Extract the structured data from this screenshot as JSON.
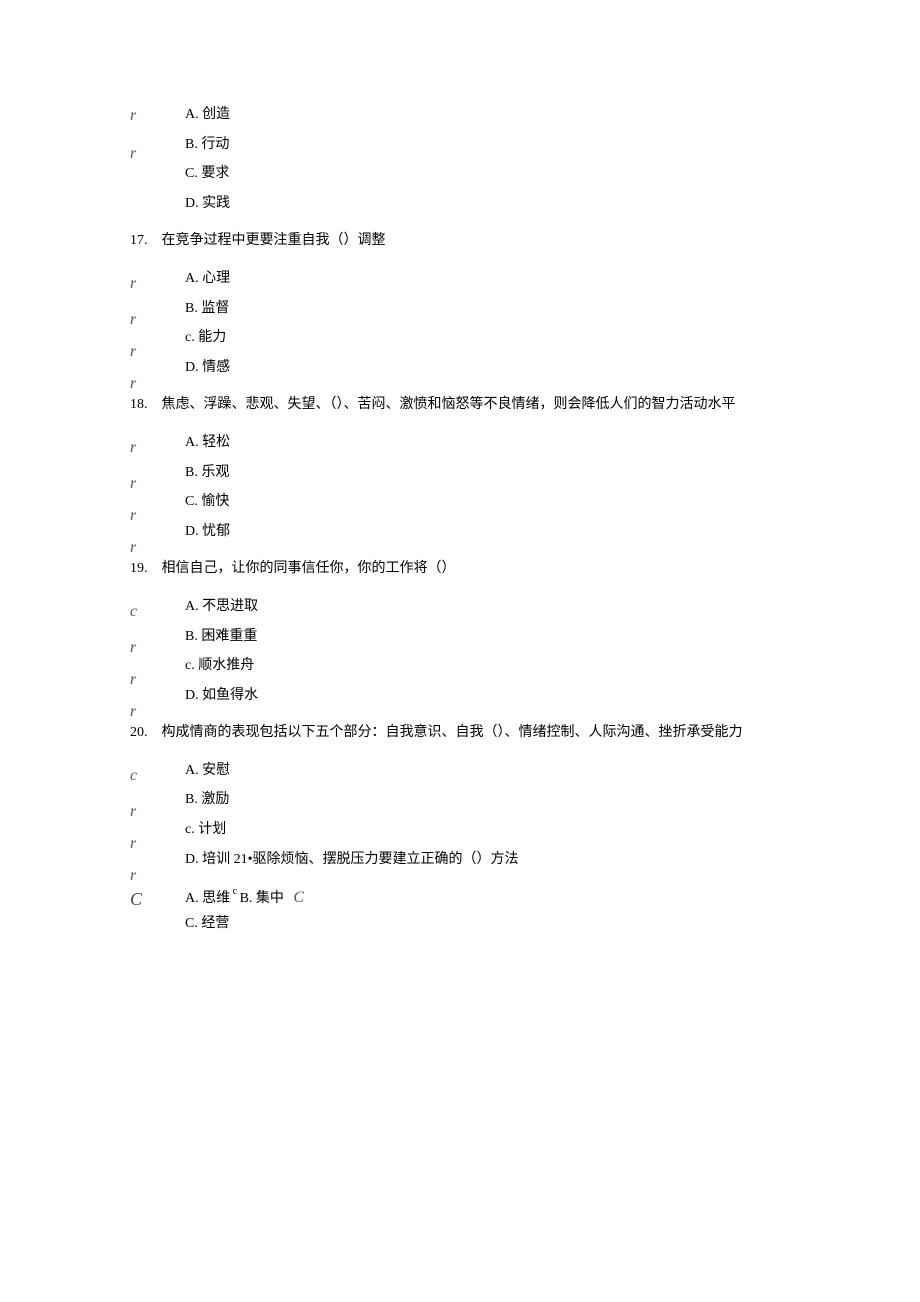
{
  "q16": {
    "options": {
      "a": "A.  创造",
      "b": "B.  行动",
      "c": "C.  要求",
      "d": "D.  实践"
    }
  },
  "q17": {
    "number": "17.",
    "text": "在竞争过程中更要注重自我（）调整",
    "options": {
      "a": "A.  心理",
      "b": "B.  监督",
      "c": "c. 能力",
      "d": "D. 情感"
    }
  },
  "q18": {
    "number": "18.",
    "text": "焦虑、浮躁、悲观、失望、（）、苦闷、激愤和恼怒等不良情绪，则会降低人们的智力活动水平",
    "options": {
      "a": "A.  轻松",
      "b": "B.  乐观",
      "c": "C.  愉快",
      "d": "D.  忧郁"
    }
  },
  "q19": {
    "number": "19.",
    "text": "相信自己，让你的同事信任你，你的工作将（）",
    "options": {
      "a": "A.  不思进取",
      "b": "B.  困难重重",
      "c": "c. 顺水推舟",
      "d": "D. 如鱼得水"
    }
  },
  "q20": {
    "number": "20.",
    "text": "构成情商的表现包括以下五个部分：自我意识、自我（）、情绪控制、人际沟通、挫折承受能力",
    "options": {
      "a": "A.  安慰",
      "b": "B.  激励",
      "c": "c. 计划",
      "d": "D. 培训 21•驱除烦恼、摆脱压力要建立正确的（）方法"
    }
  },
  "q21": {
    "options": {
      "a": "A.   思维",
      "sup": " c ",
      "b": "B. 集中",
      "c": "C.  经营"
    }
  },
  "markers": {
    "r": "r",
    "c": "c",
    "capC": "C"
  }
}
